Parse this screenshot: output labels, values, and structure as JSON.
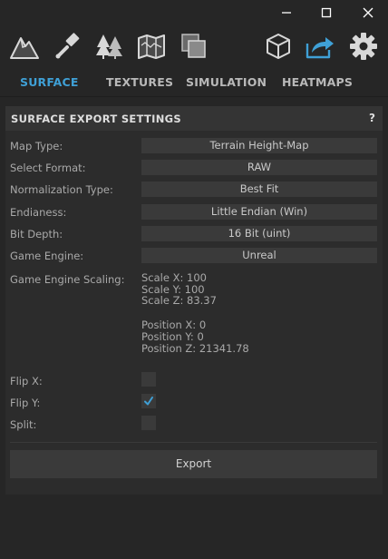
{
  "window_controls": {
    "minimize_icon": "minimize-icon",
    "maximize_icon": "maximize-icon",
    "close_icon": "close-icon"
  },
  "toolbar": {
    "icons": [
      "mountain-icon",
      "brush-icon",
      "trees-icon",
      "map-icon",
      "layers-icon",
      "cube-icon",
      "share-export-icon",
      "gear-icon"
    ],
    "active_icon": "share-export-icon",
    "accent_color": "#3fa0d6"
  },
  "tabs": [
    {
      "label": "SURFACE",
      "active": true
    },
    {
      "label": "TEXTURES",
      "active": false
    },
    {
      "label": "SIMULATION",
      "active": false
    },
    {
      "label": "HEATMAPS",
      "active": false
    }
  ],
  "panel": {
    "title": "SURFACE EXPORT SETTINGS",
    "help_label": "?",
    "fields": {
      "map_type": {
        "label": "Map Type:",
        "value": "Terrain Height-Map"
      },
      "select_format": {
        "label": "Select Format:",
        "value": "RAW"
      },
      "normalization_type": {
        "label": "Normalization Type:",
        "value": "Best Fit"
      },
      "endianess": {
        "label": "Endianess:",
        "value": "Little Endian (Win)"
      },
      "bit_depth": {
        "label": "Bit Depth:",
        "value": "16 Bit (uint)"
      },
      "game_engine": {
        "label": "Game Engine:",
        "value": "Unreal"
      }
    },
    "scaling": {
      "label": "Game Engine Scaling:",
      "scale_x": "Scale X: 100",
      "scale_y": "Scale Y: 100",
      "scale_z": "Scale Z: 83.37",
      "position_x": "Position X: 0",
      "position_y": "Position Y: 0",
      "position_z": "Position Z: 21341.78"
    },
    "checkboxes": {
      "flip_x": {
        "label": "Flip X:",
        "checked": false
      },
      "flip_y": {
        "label": "Flip Y:",
        "checked": true
      },
      "split": {
        "label": "Split:",
        "checked": false
      }
    },
    "export_label": "Export"
  }
}
